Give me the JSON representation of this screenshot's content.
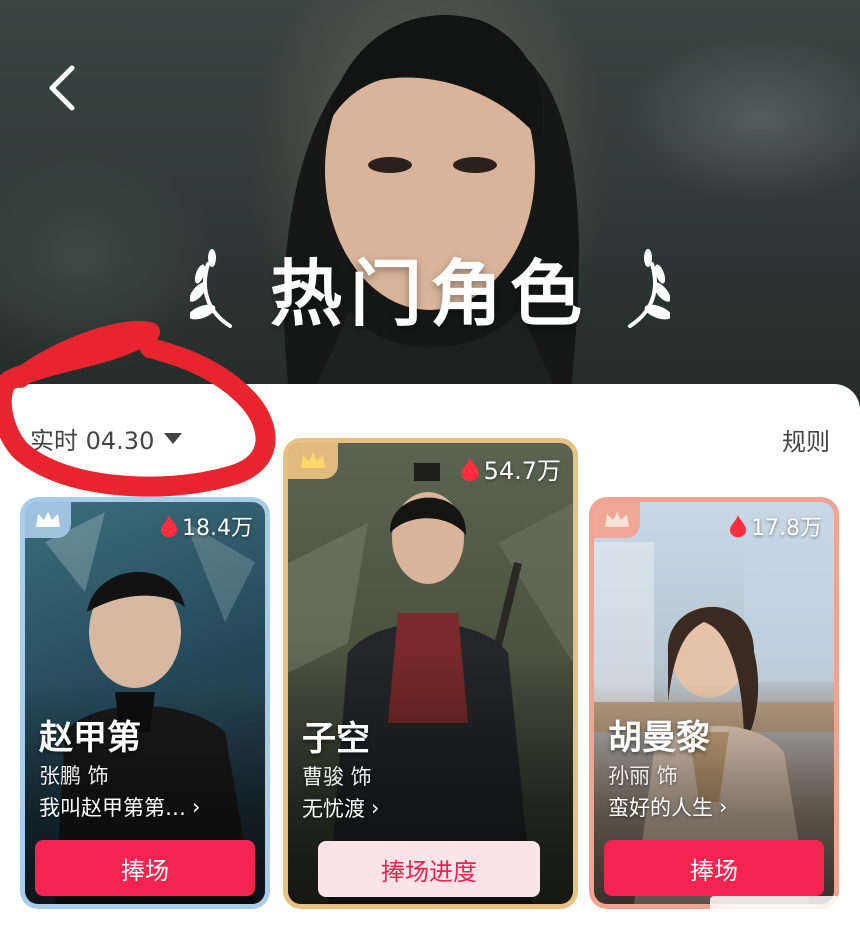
{
  "hero": {
    "title": "热门角色",
    "back_icon": "chevron-left-icon"
  },
  "toolbar": {
    "date_label": "实时 04.30",
    "rules_label": "规则"
  },
  "colors": {
    "accent_red": "#f3244f",
    "gold_border": "#e8c07f",
    "blue_border": "#a8cdeb",
    "salmon_border": "#f2a38f",
    "annotation_red": "#e8252e"
  },
  "cards": [
    {
      "rank": "2",
      "heat": "18.4万",
      "role": "赵甲第",
      "actor": "张鹏 饰",
      "show": "我叫赵甲第第…",
      "button": "捧场"
    },
    {
      "rank": "1",
      "heat": "54.7万",
      "role": "子空",
      "actor": "曹骏 饰",
      "show": "无忧渡",
      "button": "捧场进度"
    },
    {
      "rank": "3",
      "heat": "17.8万",
      "role": "胡曼黎",
      "actor": "孙丽 饰",
      "show": "蛮好的人生",
      "button": "捧场"
    }
  ]
}
